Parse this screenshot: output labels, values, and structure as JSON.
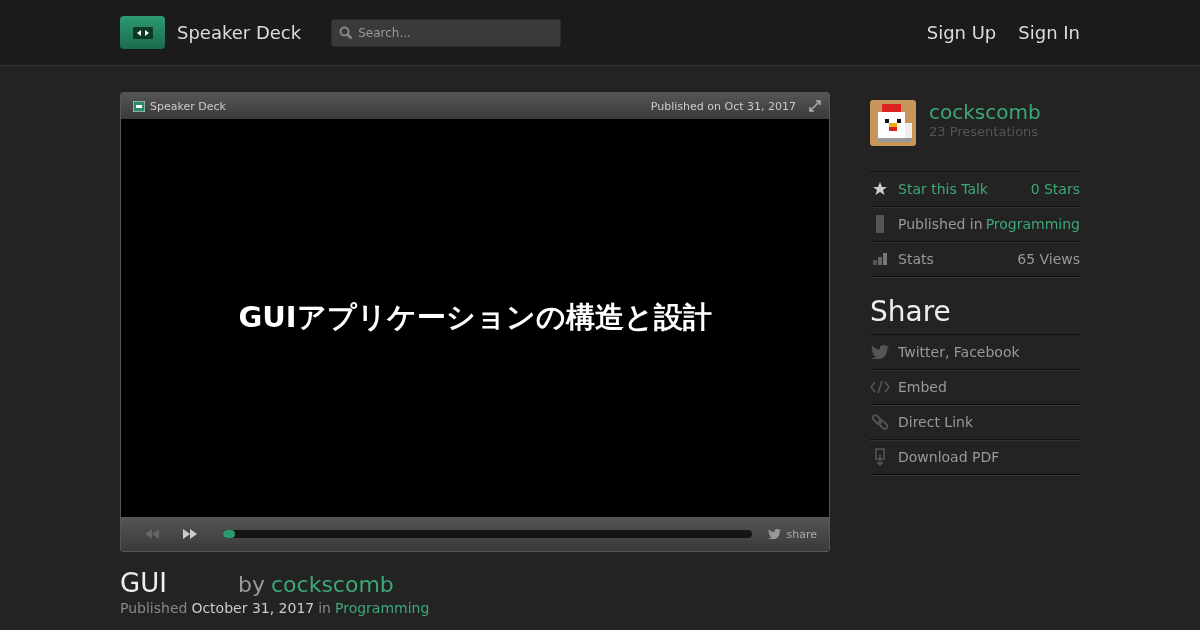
{
  "header": {
    "brand": "Speaker Deck",
    "search": {
      "placeholder": "Search..."
    },
    "nav": [
      "Sign Up",
      "Sign In"
    ]
  },
  "player": {
    "brand": "Speaker Deck",
    "published": "Published on Oct 31, 2017",
    "slide_title": "GUIアプリケーションの構造と設計",
    "controls": [
      {
        "kind": "prev",
        "disabled": true
      },
      {
        "kind": "next",
        "disabled": false
      }
    ],
    "progress": {
      "level": 0.02
    },
    "share": "share"
  },
  "talk": {
    "title": "GUI",
    "by": "by",
    "author": "cockscomb",
    "published_label": "Published",
    "date": "October 31, 2017",
    "in": "in",
    "category": "Programming"
  },
  "sidebar": {
    "author": {
      "name": "cockscomb",
      "count": "23 Presentations"
    },
    "info": [
      {
        "kind": "star",
        "label": "Star this Talk",
        "value": "0 Stars",
        "accent": true
      },
      {
        "kind": "category",
        "label": "Published in",
        "value": "Programming",
        "accent": false
      },
      {
        "kind": "stats",
        "label": "Stats",
        "value": "65 Views",
        "accent": false
      }
    ],
    "share_heading": "Share",
    "share": [
      {
        "kind": "bird",
        "label": "Twitter, Facebook"
      },
      {
        "kind": "code",
        "label": "Embed"
      },
      {
        "kind": "link",
        "label": "Direct Link"
      },
      {
        "kind": "download",
        "label": "Download PDF"
      }
    ]
  }
}
